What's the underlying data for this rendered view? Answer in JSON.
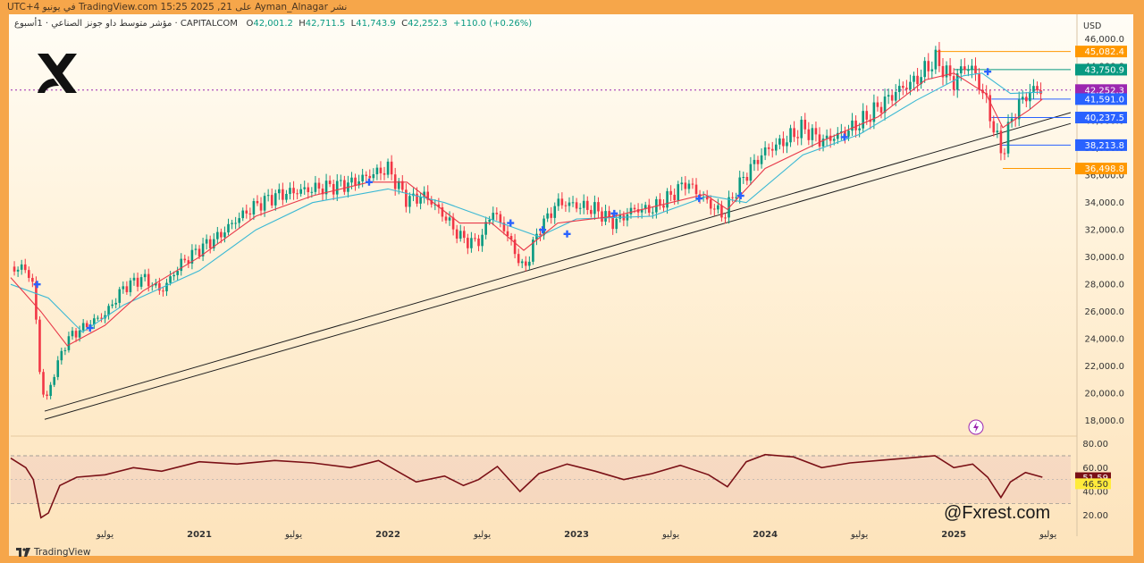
{
  "publisher_line": "نشر Ayman_Alnagar على TradingView.com 15:25 2025 ,21 في يونيو UTC+4",
  "legend": {
    "symbol": "مؤشر متوسط داو جونز الصناعي · 1أسبوع · CAPITALCOM",
    "open_label": "O",
    "open": "42,001.2",
    "high_label": "H",
    "high": "42,711.5",
    "low_label": "L",
    "low": "41,743.9",
    "close_label": "C",
    "close": "42,252.3",
    "change": "+110.0 (+0.26%)"
  },
  "currency": "USD",
  "watermark": "@Fxrest.com",
  "footer_brand": "TradingView",
  "colors": {
    "up": "#089981",
    "down": "#f23645",
    "ma_fast": "#e8394a",
    "ma_slow": "#3ab8d4",
    "rsi": "#7a1016",
    "bg_orange": "#f6a64a"
  },
  "chart_data": {
    "type": "candlestick",
    "timeframe": "1W",
    "price_axis": {
      "min": 17000,
      "max": 46500,
      "ticks": [
        "18,000.0",
        "20,000.0",
        "22,000.0",
        "24,000.0",
        "26,000.0",
        "28,000.0",
        "30,000.0",
        "32,000.0",
        "34,000.0",
        "36,000.0",
        "38,000.0",
        "40,000.0",
        "42,000.0",
        "44,000.0",
        "46,000.0"
      ]
    },
    "time_axis": {
      "labels": [
        "يوليو",
        "2021",
        "يوليو",
        "2022",
        "يوليو",
        "2023",
        "يوليو",
        "2024",
        "يوليو",
        "2025",
        "يوليو"
      ],
      "dates": [
        2020.5,
        2021.0,
        2021.5,
        2022.0,
        2022.5,
        2023.0,
        2023.5,
        2024.0,
        2024.5,
        2025.0,
        2025.5
      ],
      "range": [
        2020.0,
        2025.62
      ]
    },
    "price_path": [
      [
        2020.0,
        29300
      ],
      [
        2020.08,
        29100
      ],
      [
        2020.12,
        28000
      ],
      [
        2020.16,
        20500
      ],
      [
        2020.19,
        19500
      ],
      [
        2020.23,
        21500
      ],
      [
        2020.3,
        24000
      ],
      [
        2020.4,
        25000
      ],
      [
        2020.5,
        25800
      ],
      [
        2020.6,
        27800
      ],
      [
        2020.7,
        28500
      ],
      [
        2020.8,
        27500
      ],
      [
        2020.9,
        29500
      ],
      [
        2021.0,
        30600
      ],
      [
        2021.1,
        31500
      ],
      [
        2021.2,
        32800
      ],
      [
        2021.3,
        33800
      ],
      [
        2021.4,
        34500
      ],
      [
        2021.5,
        34800
      ],
      [
        2021.6,
        35000
      ],
      [
        2021.7,
        35200
      ],
      [
        2021.8,
        35400
      ],
      [
        2021.9,
        36000
      ],
      [
        2022.0,
        36500
      ],
      [
        2022.05,
        35300
      ],
      [
        2022.1,
        34200
      ],
      [
        2022.2,
        34500
      ],
      [
        2022.3,
        33000
      ],
      [
        2022.38,
        31500
      ],
      [
        2022.45,
        31000
      ],
      [
        2022.5,
        31500
      ],
      [
        2022.55,
        33500
      ],
      [
        2022.62,
        32000
      ],
      [
        2022.72,
        29000
      ],
      [
        2022.8,
        32000
      ],
      [
        2022.9,
        34000
      ],
      [
        2023.0,
        33800
      ],
      [
        2023.1,
        33500
      ],
      [
        2023.2,
        32500
      ],
      [
        2023.3,
        33500
      ],
      [
        2023.4,
        33500
      ],
      [
        2023.5,
        34500
      ],
      [
        2023.58,
        35500
      ],
      [
        2023.68,
        34200
      ],
      [
        2023.78,
        33000
      ],
      [
        2023.84,
        34800
      ],
      [
        2023.92,
        36500
      ],
      [
        2024.0,
        37800
      ],
      [
        2024.1,
        38500
      ],
      [
        2024.2,
        39500
      ],
      [
        2024.3,
        38500
      ],
      [
        2024.4,
        39000
      ],
      [
        2024.5,
        39800
      ],
      [
        2024.6,
        41000
      ],
      [
        2024.7,
        42200
      ],
      [
        2024.8,
        43000
      ],
      [
        2024.9,
        44500
      ],
      [
        2024.95,
        43700
      ],
      [
        2025.0,
        42800
      ],
      [
        2025.05,
        44000
      ],
      [
        2025.1,
        43800
      ],
      [
        2025.17,
        41500
      ],
      [
        2025.22,
        39000
      ],
      [
        2025.26,
        37500
      ],
      [
        2025.3,
        40000
      ],
      [
        2025.36,
        41500
      ],
      [
        2025.42,
        42300
      ],
      [
        2025.47,
        42252
      ]
    ],
    "ma_fast_path": [
      [
        2020.0,
        28500
      ],
      [
        2020.16,
        26000
      ],
      [
        2020.3,
        23500
      ],
      [
        2020.5,
        25000
      ],
      [
        2020.7,
        27500
      ],
      [
        2021.0,
        30000
      ],
      [
        2021.3,
        33000
      ],
      [
        2021.6,
        34500
      ],
      [
        2021.9,
        35500
      ],
      [
        2022.1,
        35500
      ],
      [
        2022.38,
        32500
      ],
      [
        2022.55,
        32500
      ],
      [
        2022.72,
        30500
      ],
      [
        2022.9,
        32500
      ],
      [
        2023.2,
        33000
      ],
      [
        2023.5,
        34000
      ],
      [
        2023.68,
        34600
      ],
      [
        2023.8,
        33500
      ],
      [
        2024.0,
        36500
      ],
      [
        2024.3,
        38500
      ],
      [
        2024.6,
        40300
      ],
      [
        2024.85,
        43000
      ],
      [
        2025.0,
        43500
      ],
      [
        2025.17,
        42000
      ],
      [
        2025.26,
        39500
      ],
      [
        2025.4,
        40800
      ],
      [
        2025.47,
        41591
      ]
    ],
    "ma_slow_path": [
      [
        2020.0,
        28000
      ],
      [
        2020.2,
        27000
      ],
      [
        2020.38,
        24500
      ],
      [
        2020.6,
        26500
      ],
      [
        2021.0,
        29000
      ],
      [
        2021.3,
        32000
      ],
      [
        2021.6,
        34000
      ],
      [
        2022.0,
        35000
      ],
      [
        2022.3,
        34000
      ],
      [
        2022.6,
        32500
      ],
      [
        2022.8,
        31500
      ],
      [
        2023.0,
        32800
      ],
      [
        2023.4,
        33000
      ],
      [
        2023.7,
        34500
      ],
      [
        2023.9,
        34000
      ],
      [
        2024.2,
        37500
      ],
      [
        2024.5,
        39000
      ],
      [
        2024.8,
        41500
      ],
      [
        2025.05,
        43300
      ],
      [
        2025.15,
        43500
      ],
      [
        2025.3,
        42000
      ],
      [
        2025.47,
        42100
      ]
    ],
    "trendlines": [
      {
        "from": [
          2020.18,
          18700
        ],
        "to": [
          2025.62,
          40600
        ]
      },
      {
        "from": [
          2020.18,
          18100
        ],
        "to": [
          2025.62,
          39800
        ]
      }
    ],
    "horizontal_levels": [
      {
        "price": 45082.4,
        "label": "45,082.4",
        "color": "#ff9800",
        "from": 2024.9
      },
      {
        "price": 43750.9,
        "label": "43,750.9",
        "color": "#089981",
        "from": 2025.0
      },
      {
        "price": 42252.3,
        "label": "42,252.3",
        "color": "#9c27b0",
        "from": 2020.0,
        "dotted": true
      },
      {
        "price": 41591.0,
        "label": "41,591.0",
        "color": "#2962ff",
        "from": 2025.2
      },
      {
        "price": 40237.5,
        "label": "40,237.5",
        "color": "#2962ff",
        "from": 2025.2
      },
      {
        "price": 38213.8,
        "label": "38,213.8",
        "color": "#2962ff",
        "from": 2025.25
      },
      {
        "price": 36498.8,
        "label": "36,498.8",
        "color": "#ff9800",
        "from": 2025.26
      }
    ],
    "crossover_markers": [
      [
        2020.14,
        28000
      ],
      [
        2020.42,
        24800
      ],
      [
        2021.9,
        35500
      ],
      [
        2022.65,
        32500
      ],
      [
        2022.82,
        32000
      ],
      [
        2022.95,
        31700
      ],
      [
        2023.2,
        33200
      ],
      [
        2023.65,
        34300
      ],
      [
        2023.87,
        34500
      ],
      [
        2024.42,
        38800
      ],
      [
        2025.18,
        43600
      ]
    ],
    "rsi": {
      "axis": {
        "min": 10,
        "max": 85,
        "ticks": [
          "80.00",
          "60.00",
          "40.00",
          "20.00"
        ]
      },
      "band": [
        30,
        70
      ],
      "current_labels": [
        "51.59",
        "46.50"
      ],
      "path": [
        [
          2020.0,
          68
        ],
        [
          2020.08,
          60
        ],
        [
          2020.12,
          50
        ],
        [
          2020.16,
          18
        ],
        [
          2020.2,
          22
        ],
        [
          2020.26,
          45
        ],
        [
          2020.35,
          52
        ],
        [
          2020.5,
          54
        ],
        [
          2020.65,
          60
        ],
        [
          2020.8,
          57
        ],
        [
          2021.0,
          65
        ],
        [
          2021.2,
          63
        ],
        [
          2021.4,
          66
        ],
        [
          2021.6,
          64
        ],
        [
          2021.8,
          60
        ],
        [
          2021.95,
          66
        ],
        [
          2022.05,
          57
        ],
        [
          2022.15,
          48
        ],
        [
          2022.3,
          53
        ],
        [
          2022.4,
          45
        ],
        [
          2022.48,
          50
        ],
        [
          2022.58,
          61
        ],
        [
          2022.7,
          40
        ],
        [
          2022.8,
          55
        ],
        [
          2022.95,
          63
        ],
        [
          2023.1,
          57
        ],
        [
          2023.25,
          50
        ],
        [
          2023.4,
          55
        ],
        [
          2023.55,
          62
        ],
        [
          2023.7,
          54
        ],
        [
          2023.8,
          44
        ],
        [
          2023.9,
          65
        ],
        [
          2024.0,
          71
        ],
        [
          2024.15,
          69
        ],
        [
          2024.3,
          60
        ],
        [
          2024.45,
          64
        ],
        [
          2024.6,
          66
        ],
        [
          2024.75,
          68
        ],
        [
          2024.9,
          70
        ],
        [
          2025.0,
          60
        ],
        [
          2025.1,
          63
        ],
        [
          2025.18,
          52
        ],
        [
          2025.25,
          35
        ],
        [
          2025.3,
          48
        ],
        [
          2025.38,
          56
        ],
        [
          2025.47,
          52
        ]
      ]
    }
  }
}
